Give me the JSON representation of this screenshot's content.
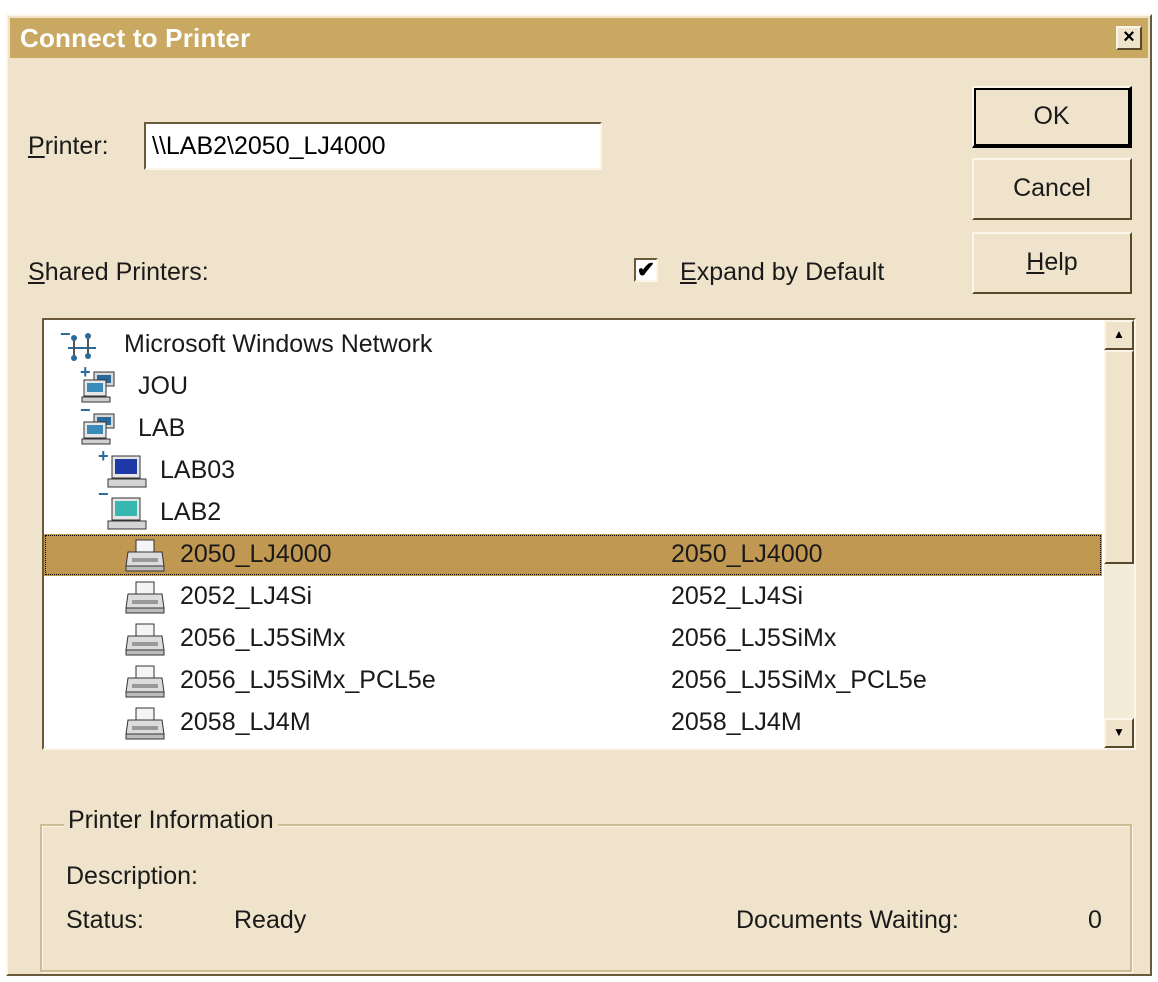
{
  "window": {
    "title": "Connect to Printer",
    "close_glyph": "×"
  },
  "printer_field": {
    "label_key": "P",
    "label_rest": "rinter:",
    "value": "\\\\LAB2\\2050_LJ4000"
  },
  "buttons": {
    "ok": "OK",
    "cancel": "Cancel",
    "help_key": "H",
    "help_rest": "elp"
  },
  "shared_printers": {
    "label_key": "S",
    "label_rest": "hared Printers:"
  },
  "expand_by_default": {
    "label_key": "E",
    "label_rest": "xpand by Default",
    "checked": true
  },
  "tree": {
    "items": [
      {
        "label": "Microsoft Windows Network",
        "icon": "network-icon",
        "expander": "−",
        "level": 0
      },
      {
        "label": "JOU",
        "icon": "workgroup-icon",
        "expander": "+",
        "level": 1
      },
      {
        "label": "LAB",
        "icon": "workgroup-icon",
        "expander": "−",
        "level": 1
      },
      {
        "label": "LAB03",
        "icon": "computer-icon",
        "expander": "+",
        "level": 2
      },
      {
        "label": "LAB2",
        "icon": "computer-icon",
        "expander": "−",
        "level": 2
      },
      {
        "label": "2050_LJ4000",
        "comment": "2050_LJ4000",
        "icon": "printer-icon",
        "level": 3,
        "selected": true
      },
      {
        "label": "2052_LJ4Si",
        "comment": "2052_LJ4Si",
        "icon": "printer-icon",
        "level": 3
      },
      {
        "label": "2056_LJ5SiMx",
        "comment": "2056_LJ5SiMx",
        "icon": "printer-icon",
        "level": 3
      },
      {
        "label": "2056_LJ5SiMx_PCL5e",
        "comment": "2056_LJ5SiMx_PCL5e",
        "icon": "printer-icon",
        "level": 3
      },
      {
        "label": "2058_LJ4M",
        "comment": "2058_LJ4M",
        "icon": "printer-icon",
        "level": 3
      }
    ]
  },
  "printer_information": {
    "legend": "Printer Information",
    "description_label": "Description:",
    "status_label": "Status:",
    "status_value": "Ready",
    "documents_waiting_label": "Documents Waiting:",
    "documents_waiting_value": "0"
  },
  "colors": {
    "title_bar": "#c9a862",
    "dialog_face": "#efe4cb",
    "selection": "#c19852"
  }
}
